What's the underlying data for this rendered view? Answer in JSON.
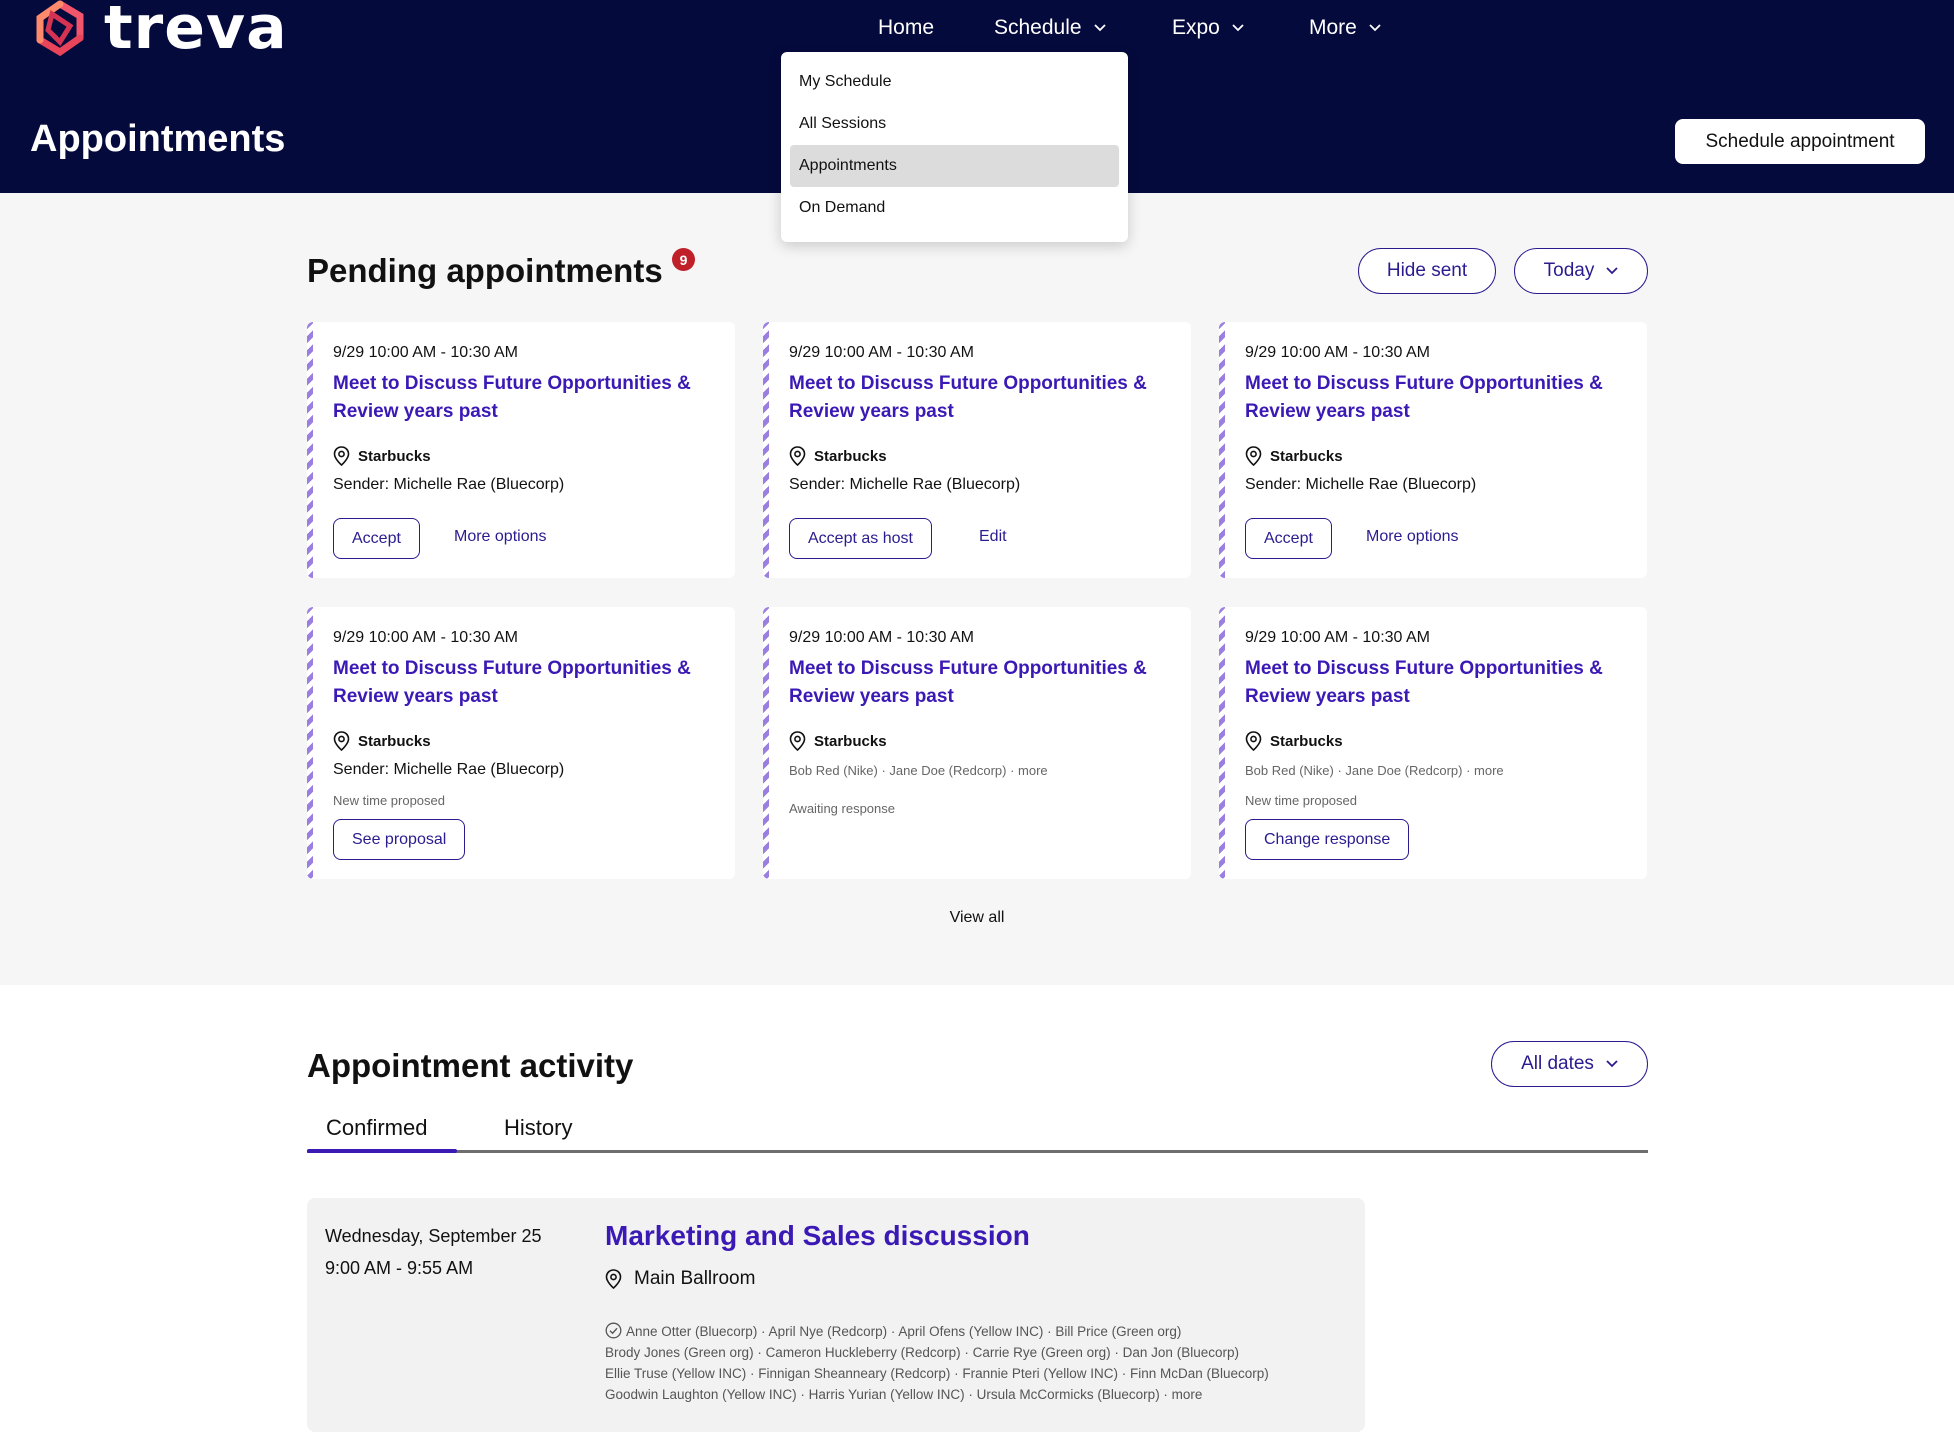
{
  "brand": {
    "name": "treva"
  },
  "nav": {
    "home": "Home",
    "schedule": "Schedule",
    "expo": "Expo",
    "more": "More"
  },
  "dropdown": {
    "items": [
      "My Schedule",
      "All Sessions",
      "Appointments",
      "On Demand"
    ],
    "selected": "Appointments"
  },
  "header": {
    "title": "Appointments",
    "schedule_button": "Schedule appointment"
  },
  "pending": {
    "title": "Pending appointments",
    "badge_count": "9",
    "hide_sent": "Hide sent",
    "date_filter": "Today",
    "view_all": "View all",
    "cards": [
      {
        "time": "9/29 10:00 AM - 10:30 AM",
        "title": "Meet to Discuss Future Opportunities & Review years past",
        "location": "Starbucks",
        "sender": "Sender: Michelle Rae (Bluecorp)",
        "primary": "Accept",
        "secondary": "More options"
      },
      {
        "time": "9/29 10:00 AM - 10:30 AM",
        "title": "Meet to Discuss Future Opportunities & Review years past",
        "location": "Starbucks",
        "sender": "Sender: Michelle Rae (Bluecorp)",
        "primary": "Accept as host",
        "secondary": "Edit"
      },
      {
        "time": "9/29 10:00 AM - 10:30 AM",
        "title": "Meet to Discuss Future Opportunities & Review years past",
        "location": "Starbucks",
        "sender": "Sender: Michelle Rae (Bluecorp)",
        "primary": "Accept",
        "secondary": "More options"
      },
      {
        "time": "9/29 10:00 AM - 10:30 AM",
        "title": "Meet to Discuss Future Opportunities & Review years past",
        "location": "Starbucks",
        "sender": "Sender: Michelle Rae (Bluecorp)",
        "note": "New time proposed",
        "primary": "See proposal"
      },
      {
        "time": "9/29 10:00 AM - 10:30 AM",
        "title": "Meet to Discuss Future Opportunities & Review years past",
        "location": "Starbucks",
        "people": "Bob Red (Nike) · Jane Doe (Redcorp) · more",
        "note": "Awaiting response"
      },
      {
        "time": "9/29 10:00 AM - 10:30 AM",
        "title": "Meet to Discuss Future Opportunities & Review years past",
        "location": "Starbucks",
        "people": "Bob Red (Nike) · Jane Doe (Redcorp) · more",
        "note": "New time proposed",
        "primary": "Change response"
      }
    ]
  },
  "activity": {
    "title": "Appointment activity",
    "date_filter": "All dates",
    "tabs": [
      "Confirmed",
      "History"
    ],
    "appointment": {
      "date": "Wednesday, September 25",
      "time": "9:00 AM - 9:55 AM",
      "title": "Marketing and Sales discussion",
      "location": "Main Ballroom",
      "people_lines": [
        "Anne Otter (Bluecorp) · April Nye (Redcorp) ·  April Ofens (Yellow INC) · Bill Price (Green org)",
        "Brody Jones (Green org) · Cameron Huckleberry (Redcorp) · Carrie Rye (Green org) · Dan Jon (Bluecorp)",
        "Ellie Truse (Yellow INC) · Finnigan Sheanneary (Redcorp) · Frannie Pteri (Yellow INC) · Finn McDan (Bluecorp)",
        "Goodwin Laughton (Yellow INC) · Harris Yurian (Yellow INC) · Ursula McCormicks (Bluecorp) · more"
      ]
    }
  },
  "colors": {
    "header_bg": "#050a3d",
    "accent": "#3b19b5",
    "badge": "#c0202a",
    "stripe": "#9b7fe0"
  },
  "icons": [
    "treva-logo-icon",
    "chevron-down-icon",
    "location-pin-icon",
    "check-circle-icon"
  ]
}
